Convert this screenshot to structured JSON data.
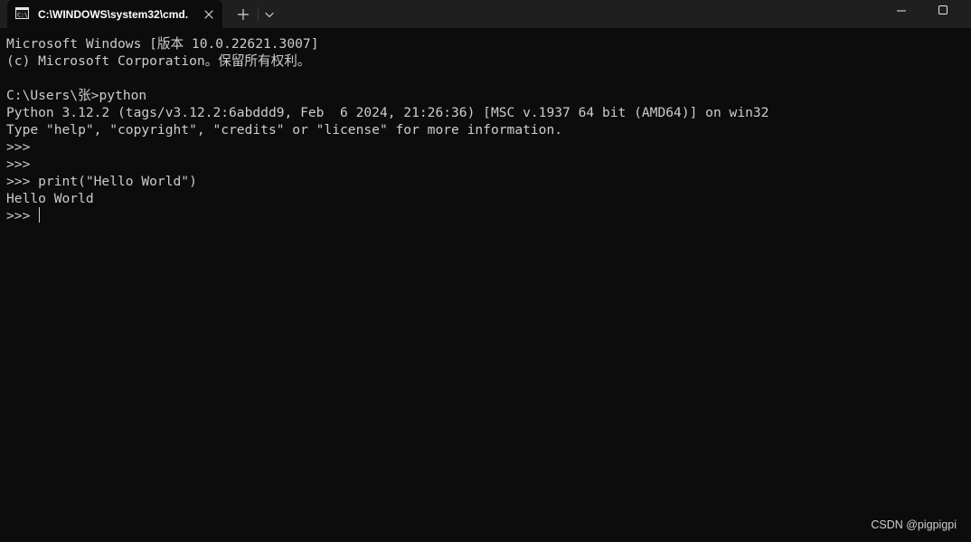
{
  "tab": {
    "title": "C:\\WINDOWS\\system32\\cmd.",
    "icon": "cmd-console-icon",
    "close_icon": "close-icon"
  },
  "titlebar": {
    "new_tab_icon": "plus-icon",
    "dropdown_icon": "chevron-down-icon",
    "minimize_icon": "minimize-icon",
    "maximize_icon": "maximize-icon"
  },
  "console": {
    "lines": [
      "Microsoft Windows [版本 10.0.22621.3007]",
      "(c) Microsoft Corporation。保留所有权利。",
      "",
      "C:\\Users\\张>python",
      "Python 3.12.2 (tags/v3.12.2:6abddd9, Feb  6 2024, 21:26:36) [MSC v.1937 64 bit (AMD64)] on win32",
      "Type \"help\", \"copyright\", \"credits\" or \"license\" for more information.",
      ">>>",
      ">>>",
      ">>> print(\"Hello World\")",
      "Hello World"
    ],
    "active_prompt": ">>> "
  },
  "watermark": "CSDN @pigpigpi",
  "colors": {
    "background": "#0c0c0c",
    "titlebar": "#1f1f1f",
    "text": "#cccccc"
  }
}
